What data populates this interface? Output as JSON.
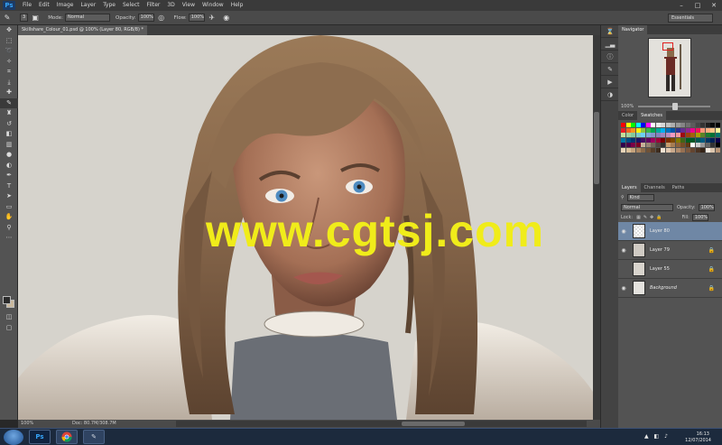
{
  "app": {
    "logo": "Ps"
  },
  "menu": [
    "File",
    "Edit",
    "Image",
    "Layer",
    "Type",
    "Select",
    "Filter",
    "3D",
    "View",
    "Window",
    "Help"
  ],
  "window_controls": [
    "–",
    "□",
    "✕"
  ],
  "options": {
    "brush_size": "3",
    "mode_label": "Mode:",
    "mode_value": "Normal",
    "opacity_label": "Opacity:",
    "opacity_value": "100%",
    "flow_label": "Flow:",
    "flow_value": "100%",
    "workspace": "Essentials"
  },
  "document": {
    "tab_title": "Skillshare_Colour_01.psd @ 100% (Layer 80, RGB/8) *",
    "watermark": "www.cgtsj.com",
    "status_zoom": "100%",
    "status_doc": "Doc: 80.7M/308.7M"
  },
  "navigator": {
    "tab": "Navigator",
    "zoom": "100%"
  },
  "color_panel": {
    "tabs": [
      "Color",
      "Swatches"
    ]
  },
  "layers_panel": {
    "tabs": [
      "Layers",
      "Channels",
      "Paths"
    ],
    "kind_label": "Kind",
    "blend_mode": "Normal",
    "opacity_label": "Opacity:",
    "opacity_value": "100%",
    "lock_label": "Lock:",
    "fill_label": "Fill:",
    "fill_value": "100%",
    "layers": [
      {
        "name": "Layer 80",
        "visible": true,
        "locked": false,
        "selected": true
      },
      {
        "name": "Layer 79",
        "visible": true,
        "locked": true,
        "selected": false
      },
      {
        "name": "Layer 55",
        "visible": false,
        "locked": true,
        "selected": false
      },
      {
        "name": "Background",
        "visible": true,
        "locked": true,
        "selected": false
      }
    ]
  },
  "taskbar": {
    "time": "16:13",
    "date": "12/07/2014",
    "apps": [
      "Ps",
      "",
      ""
    ]
  },
  "colors": {
    "accent_selected": "#6f87a5",
    "ps_blue": "#36a3f7",
    "watermark": "#f0ec1a",
    "hair": "#8a6a4a",
    "fur": "#ece6dc"
  },
  "swatches": [
    "#ff0000",
    "#ffff00",
    "#00ff00",
    "#00ffff",
    "#0000ff",
    "#ff00ff",
    "#ffffff",
    "#ebebeb",
    "#d6d6d6",
    "#c2c2c2",
    "#adadad",
    "#999999",
    "#858585",
    "#707070",
    "#5c5c5c",
    "#474747",
    "#333333",
    "#1f1f1f",
    "#0a0a0a",
    "#000000",
    "#ed1c24",
    "#f26522",
    "#f7941d",
    "#fff200",
    "#8dc63f",
    "#39b54a",
    "#00a651",
    "#00a99d",
    "#00aeef",
    "#0072bc",
    "#0054a6",
    "#2e3192",
    "#662d91",
    "#92278f",
    "#ec008c",
    "#ed145b",
    "#f7977a",
    "#f9ad81",
    "#fdc68a",
    "#fff79a",
    "#c4df9b",
    "#a3d39c",
    "#82ca9d",
    "#7accc8",
    "#6dcff6",
    "#7da7d9",
    "#8393ca",
    "#8781bd",
    "#a186be",
    "#bd8cbf",
    "#f49ac2",
    "#f6989d",
    "#9e0b0f",
    "#a0410d",
    "#a36209",
    "#aba000",
    "#598527",
    "#1a7b30",
    "#007236",
    "#00746b",
    "#0076a3",
    "#004b80",
    "#003471",
    "#1b1464",
    "#440e62",
    "#630460",
    "#9e005d",
    "#9e0039",
    "#790000",
    "#7b2e00",
    "#7d4900",
    "#827b00",
    "#406618",
    "#005e20",
    "#005826",
    "#005952",
    "#005b7f",
    "#003663",
    "#002157",
    "#0d004c",
    "#32004b",
    "#4b0049",
    "#7b0046",
    "#7a0026",
    "#c7b299",
    "#998675",
    "#736357",
    "#534741",
    "#37302d",
    "#c69c6d",
    "#a67c52",
    "#8c6239",
    "#754c24",
    "#603913",
    "#ffffff",
    "#cccccc",
    "#999999",
    "#666666",
    "#333333",
    "#000000",
    "#e8d5b9",
    "#d9bf9a",
    "#c4a27c",
    "#a8835f",
    "#8a6a4a",
    "#6e5238",
    "#553e2a",
    "#3e2c1e",
    "#f2e3d3",
    "#e0c8b0",
    "#c9a98c",
    "#b08b6c",
    "#967052",
    "#7c593f",
    "#634530",
    "#4b3323",
    "#352418",
    "#f5ebe0",
    "#dcc6ae",
    "#b89576"
  ]
}
